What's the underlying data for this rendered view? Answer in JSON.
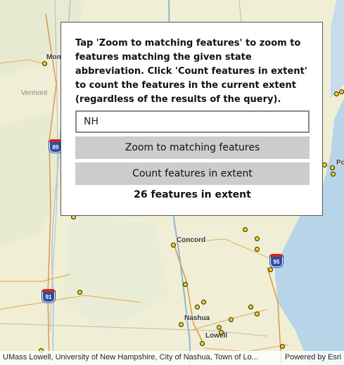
{
  "panel": {
    "instructions": "Tap 'Zoom to matching features' to zoom to features matching the given state abbreviation. Click 'Count features in extent' to count the features in the current extent (regardless of the results of the query).",
    "state_input_value": "NH",
    "zoom_button_label": "Zoom to matching features",
    "count_button_label": "Count features in extent",
    "result_text": "26 features in extent"
  },
  "map": {
    "place_labels": {
      "montpelier_partial": "Mon",
      "concord": "Concord",
      "nashua": "Nashua",
      "lowell": "Lowell",
      "portsmouth_partial": "Po"
    },
    "state_labels": {
      "vermont": "Vermont"
    },
    "highway_shields": {
      "i89": "89",
      "i91": "91",
      "i95": "95"
    },
    "colors": {
      "land": "#f2efd9",
      "water": "#b8d4e8",
      "feature_fill": "#f4d200",
      "feature_stroke": "#222222",
      "button": "#cccccc"
    }
  },
  "attribution": {
    "text": "UMass Lowell, University of New Hampshire, City of Nashua, Town of Lo...",
    "powered_by": "Powered by Esri"
  }
}
